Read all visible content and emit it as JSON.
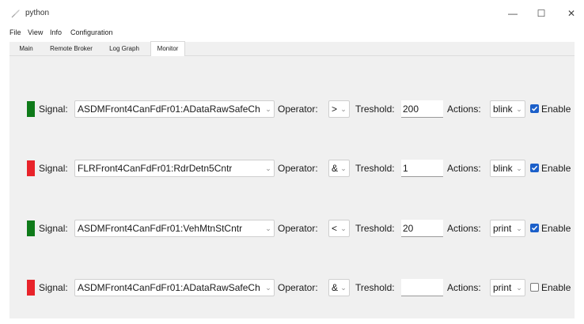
{
  "window": {
    "title": "python",
    "icon": "python-feather-icon",
    "controls": [
      "minimize-icon",
      "maximize-icon",
      "close-icon"
    ],
    "minimize_glyph": "—",
    "maximize_glyph": "☐",
    "close_glyph": "✕"
  },
  "menu": {
    "file": "File",
    "view": "View",
    "info": "Info",
    "configuration": "Configuration"
  },
  "tabs": {
    "main": "Main",
    "remote_broker": "Remote Broker",
    "log_graph": "Log Graph",
    "monitor": "Monitor",
    "active": "Monitor"
  },
  "labels": {
    "signal": "Signal:",
    "operator": "Operator:",
    "treshold": "Treshold:",
    "actions": "Actions:",
    "enable": "Enable"
  },
  "chevron_glyph": "⌄",
  "colors": {
    "green": "#0e7a19",
    "red": "#e8232a",
    "checkbox_on": "#1b5fc9"
  },
  "rows": [
    {
      "status": "green",
      "signal": "ASDMFront4CanFdFr01:ADataRawSafeCh",
      "operator": ">",
      "treshold": "200",
      "action": "blink",
      "enabled": true
    },
    {
      "status": "red",
      "signal": "FLRFront4CanFdFr01:RdrDetn5Cntr",
      "operator": "&",
      "treshold": "1",
      "action": "blink",
      "enabled": true
    },
    {
      "status": "green",
      "signal": "ASDMFront4CanFdFr01:VehMtnStCntr",
      "operator": "<",
      "treshold": "20",
      "action": "print",
      "enabled": true
    },
    {
      "status": "red",
      "signal": "ASDMFront4CanFdFr01:ADataRawSafeCh",
      "operator": "&",
      "treshold": "",
      "action": "print",
      "enabled": false
    }
  ]
}
